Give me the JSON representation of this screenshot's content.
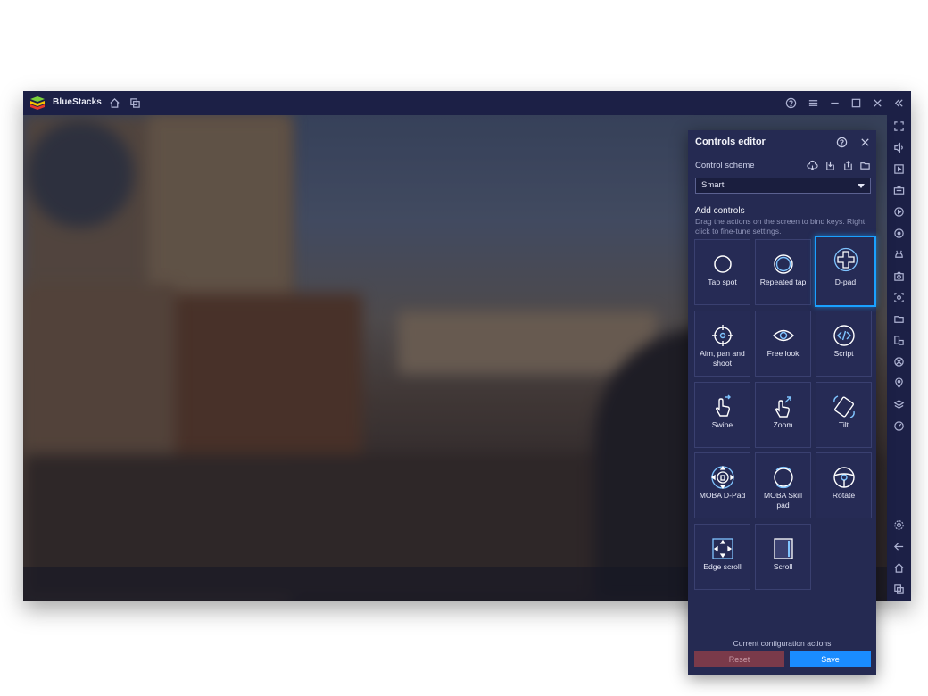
{
  "app": {
    "name": "BlueStacks"
  },
  "editor": {
    "title": "Controls editor",
    "scheme_label": "Control scheme",
    "scheme_value": "Smart",
    "add_title": "Add controls",
    "add_desc": "Drag the actions on the screen to bind keys. Right click to fine-tune settings.",
    "tiles": [
      {
        "label": "Tap spot",
        "icon": "tap-spot-icon"
      },
      {
        "label": "Repeated tap",
        "icon": "repeated-tap-icon"
      },
      {
        "label": "D-pad",
        "icon": "dpad-icon",
        "selected": true
      },
      {
        "label": "Aim, pan and shoot",
        "icon": "crosshair-icon"
      },
      {
        "label": "Free look",
        "icon": "eye-icon"
      },
      {
        "label": "Script",
        "icon": "code-icon"
      },
      {
        "label": "Swipe",
        "icon": "swipe-hand-icon"
      },
      {
        "label": "Zoom",
        "icon": "zoom-hand-icon"
      },
      {
        "label": "Tilt",
        "icon": "tilt-icon"
      },
      {
        "label": "MOBA D-Pad",
        "icon": "moba-dpad-icon"
      },
      {
        "label": "MOBA Skill pad",
        "icon": "moba-skill-icon"
      },
      {
        "label": "Rotate",
        "icon": "rotate-icon"
      },
      {
        "label": "Edge scroll",
        "icon": "edge-scroll-icon"
      },
      {
        "label": "Scroll",
        "icon": "scroll-icon"
      }
    ],
    "footer_label": "Current configuration actions",
    "reset_label": "Reset",
    "save_label": "Save"
  },
  "colors": {
    "accent": "#1a8cff",
    "selected_border": "#1aa1ff",
    "panel_bg": "#252a52",
    "titlebar_bg": "#1c2046"
  }
}
